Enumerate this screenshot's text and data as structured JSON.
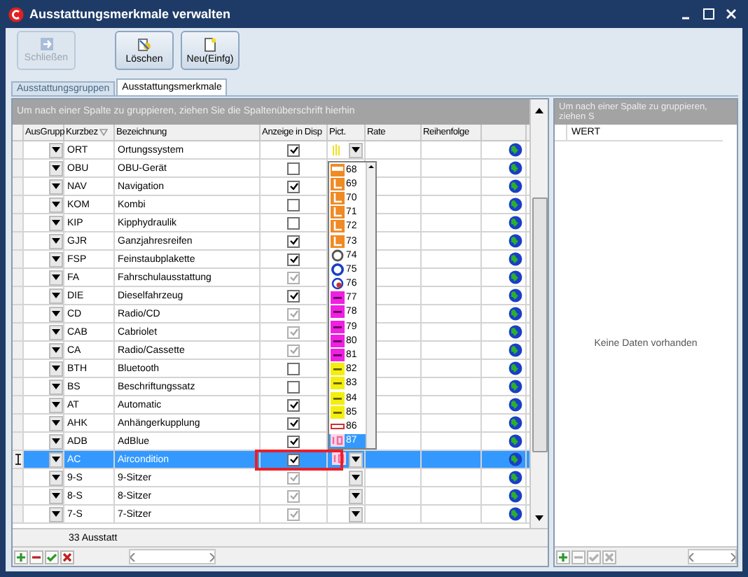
{
  "window": {
    "title": "Ausstattungsmerkmale verwalten"
  },
  "toolbar": [
    {
      "buttons": [
        {
          "label": "Schließen",
          "kind": "exit",
          "disabled": true
        }
      ]
    },
    {
      "buttons": [
        {
          "label": "Löschen",
          "kind": "delete",
          "disabled": false
        },
        {
          "label": "Neu(Einfg)",
          "kind": "new",
          "disabled": false
        }
      ]
    }
  ],
  "tabs": [
    {
      "label": "Ausstattungsgruppen",
      "selected": false
    },
    {
      "label": "Ausstattungsmerkmale",
      "selected": true
    }
  ],
  "main_grid": {
    "group_hint": "Um nach einer Spalte zu gruppieren, ziehen Sie die Spaltenüberschrift hierhin",
    "columns": [
      "AusGrupp",
      "Kurzbez",
      "Bezeichnung",
      "Anzeige in Disp",
      "Pict.",
      "Rate",
      "Reihenfolge"
    ],
    "rows": [
      {
        "code": "ORT",
        "name": "Ortungssystem",
        "display": true,
        "disabled": false,
        "pict": {
          "kind": "grip"
        },
        "selected": false,
        "marked": false
      },
      {
        "code": "OBU",
        "name": "OBU-Gerät",
        "display": false,
        "disabled": false,
        "selected": false,
        "marked": false
      },
      {
        "code": "NAV",
        "name": "Navigation",
        "display": true,
        "disabled": false,
        "selected": false,
        "marked": false
      },
      {
        "code": "KOM",
        "name": "Kombi",
        "display": false,
        "disabled": false,
        "selected": false,
        "marked": false
      },
      {
        "code": "KIP",
        "name": "Kipphydraulik",
        "display": false,
        "disabled": false,
        "selected": false,
        "marked": false
      },
      {
        "code": "GJR",
        "name": "Ganzjahresreifen",
        "display": true,
        "disabled": false,
        "selected": false,
        "marked": false
      },
      {
        "code": "FSP",
        "name": "Feinstaubplakette",
        "display": true,
        "disabled": false,
        "selected": false,
        "marked": false
      },
      {
        "code": "FA",
        "name": "Fahrschulausstattung",
        "display": true,
        "disabled": true,
        "selected": false,
        "marked": false
      },
      {
        "code": "DIE",
        "name": "Dieselfahrzeug",
        "display": true,
        "disabled": false,
        "selected": false,
        "marked": false
      },
      {
        "code": "CD",
        "name": "Radio/CD",
        "display": true,
        "disabled": true,
        "selected": false,
        "marked": false
      },
      {
        "code": "CAB",
        "name": "Cabriolet",
        "display": true,
        "disabled": true,
        "selected": false,
        "marked": false
      },
      {
        "code": "CA",
        "name": "Radio/Cassette",
        "display": true,
        "disabled": true,
        "selected": false,
        "marked": false
      },
      {
        "code": "BTH",
        "name": "Bluetooth",
        "display": false,
        "disabled": false,
        "selected": false,
        "marked": false
      },
      {
        "code": "BS",
        "name": "Beschriftungssatz",
        "display": false,
        "disabled": false,
        "selected": false,
        "marked": false
      },
      {
        "code": "AT",
        "name": "Automatic",
        "display": true,
        "disabled": false,
        "selected": false,
        "marked": false
      },
      {
        "code": "AHK",
        "name": "Anhängerkupplung",
        "display": true,
        "disabled": false,
        "selected": false,
        "marked": false
      },
      {
        "code": "ADB",
        "name": "AdBlue",
        "display": true,
        "disabled": false,
        "selected": false,
        "marked": false
      },
      {
        "code": "AC",
        "name": "Aircondition",
        "display": true,
        "disabled": false,
        "pict": {
          "kind": "tag"
        },
        "selected": true,
        "marked": true
      },
      {
        "code": "9-S",
        "name": "9-Sitzer",
        "display": true,
        "disabled": true,
        "pict": {
          "kind": "empty"
        },
        "selected": false,
        "marked": false
      },
      {
        "code": "8-S",
        "name": "8-Sitzer",
        "display": true,
        "disabled": true,
        "pict": {
          "kind": "empty"
        },
        "selected": false,
        "marked": false
      },
      {
        "code": "7-S",
        "name": "7-Sitzer",
        "display": true,
        "disabled": true,
        "pict": {
          "kind": "empty"
        },
        "selected": false,
        "marked": false
      }
    ],
    "footer": "33 Ausstatt",
    "pict_dropdown": [
      {
        "label": "68",
        "kind": "bus",
        "selected": false
      },
      {
        "label": "69",
        "kind": "seat",
        "selected": false
      },
      {
        "label": "70",
        "kind": "seat",
        "selected": false
      },
      {
        "label": "71",
        "kind": "seat",
        "selected": false
      },
      {
        "label": "72",
        "kind": "seat",
        "selected": false
      },
      {
        "label": "73",
        "kind": "seat",
        "selected": false
      },
      {
        "label": "74",
        "kind": "ring",
        "selected": false
      },
      {
        "label": "75",
        "kind": "blue",
        "selected": false
      },
      {
        "label": "76",
        "kind": "swirl",
        "selected": false
      },
      {
        "label": "77",
        "kind": "magenta",
        "selected": false
      },
      {
        "label": "78",
        "kind": "magenta",
        "selected": false
      },
      {
        "label": "79",
        "kind": "magenta",
        "selected": false
      },
      {
        "label": "80",
        "kind": "magenta",
        "selected": false
      },
      {
        "label": "81",
        "kind": "magenta",
        "selected": false
      },
      {
        "label": "82",
        "kind": "yellow",
        "selected": false
      },
      {
        "label": "83",
        "kind": "yellow",
        "selected": false
      },
      {
        "label": "84",
        "kind": "yellow",
        "selected": false
      },
      {
        "label": "85",
        "kind": "yellow",
        "selected": false
      },
      {
        "label": "86",
        "kind": "redtag",
        "selected": false
      },
      {
        "label": "87",
        "kind": "pink",
        "selected": true
      }
    ]
  },
  "value_grid": {
    "group_hint": "Um nach einer Spalte zu gruppieren, ziehen S",
    "columns": [
      "WERT"
    ],
    "empty_text": "Keine Daten vorhanden"
  }
}
